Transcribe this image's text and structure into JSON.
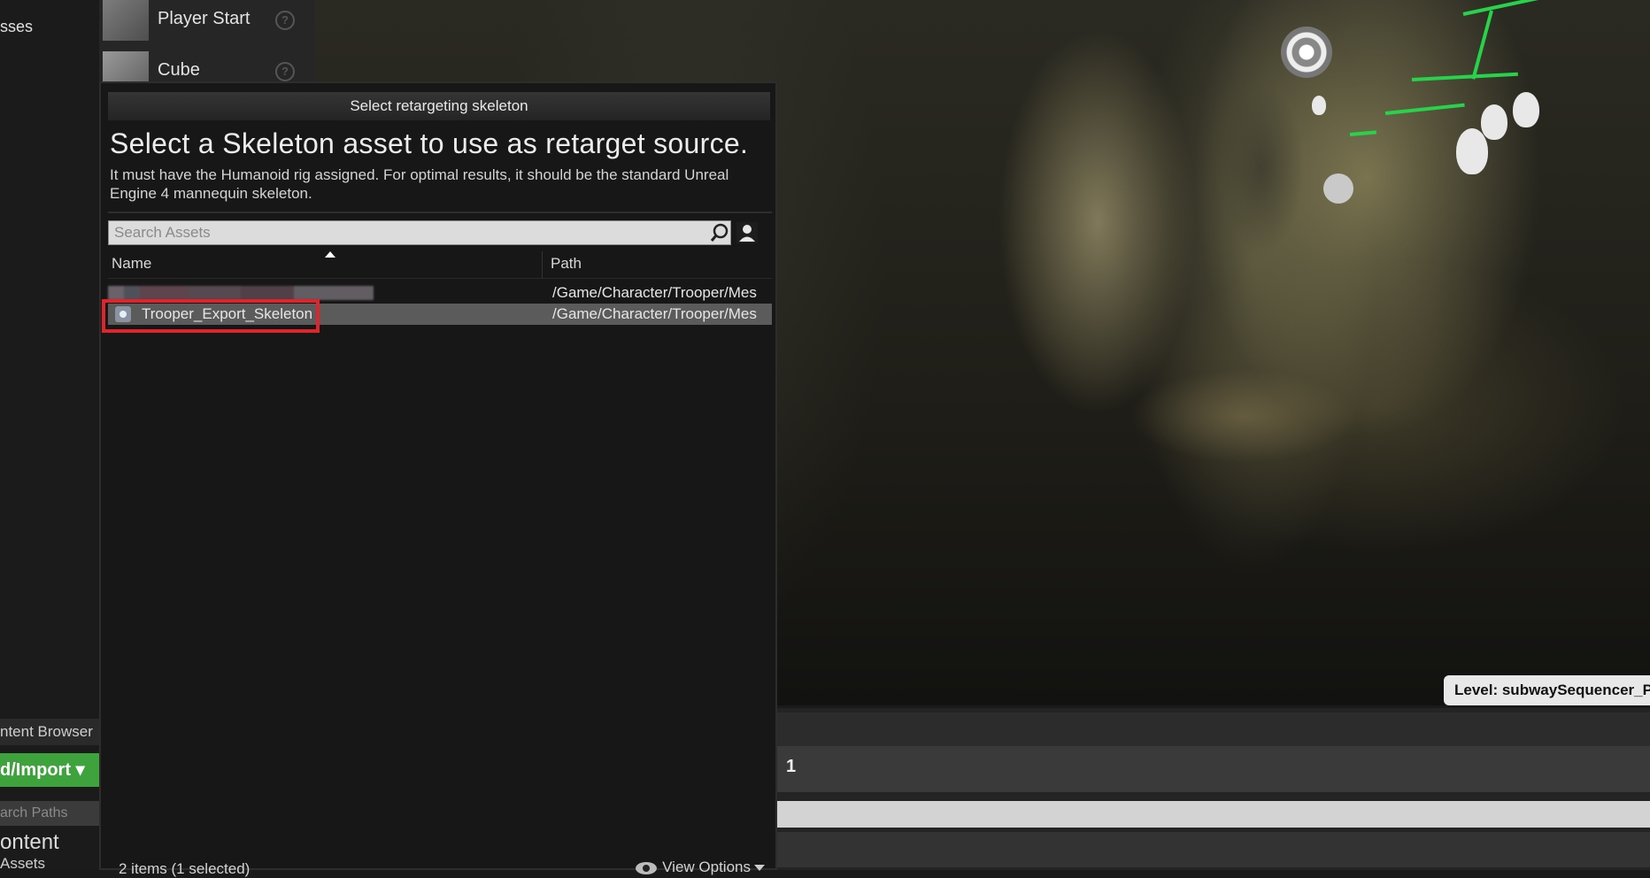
{
  "left_panel": {
    "modes_label": "sses",
    "content_browser_tab": "ntent Browser",
    "import_button": "d/Import",
    "search_paths_placeholder": "arch Paths",
    "content_root": "ontent",
    "assets_item": "Assets"
  },
  "place_actors": {
    "items": [
      {
        "label": "Player Start",
        "help": "?"
      },
      {
        "label": "Cube",
        "help": "?"
      }
    ]
  },
  "viewport": {
    "level_label": "Level:  subwaySequencer_P (Pe",
    "bottom_number": "1"
  },
  "dialog": {
    "title": "Select retargeting skeleton",
    "heading": "Select a Skeleton asset to use as retarget source.",
    "description": "It must have the Humanoid rig assigned. For optimal results, it should be the standard Unreal Engine 4 mannequin skeleton.",
    "search_placeholder": "Search Assets",
    "columns": {
      "name": "Name",
      "path": "Path"
    },
    "rows": [
      {
        "name": "",
        "path": "/Game/Character/Trooper/Mes",
        "selected": false
      },
      {
        "name": "Trooper_Export_Skeleton",
        "path": "/Game/Character/Trooper/Mes",
        "selected": true
      }
    ],
    "status": "2 items (1 selected)",
    "view_options": "View Options"
  },
  "colors": {
    "import_green": "#3ea33c",
    "highlight_red": "#e0242c",
    "selected_row": "#5b5b5b"
  }
}
